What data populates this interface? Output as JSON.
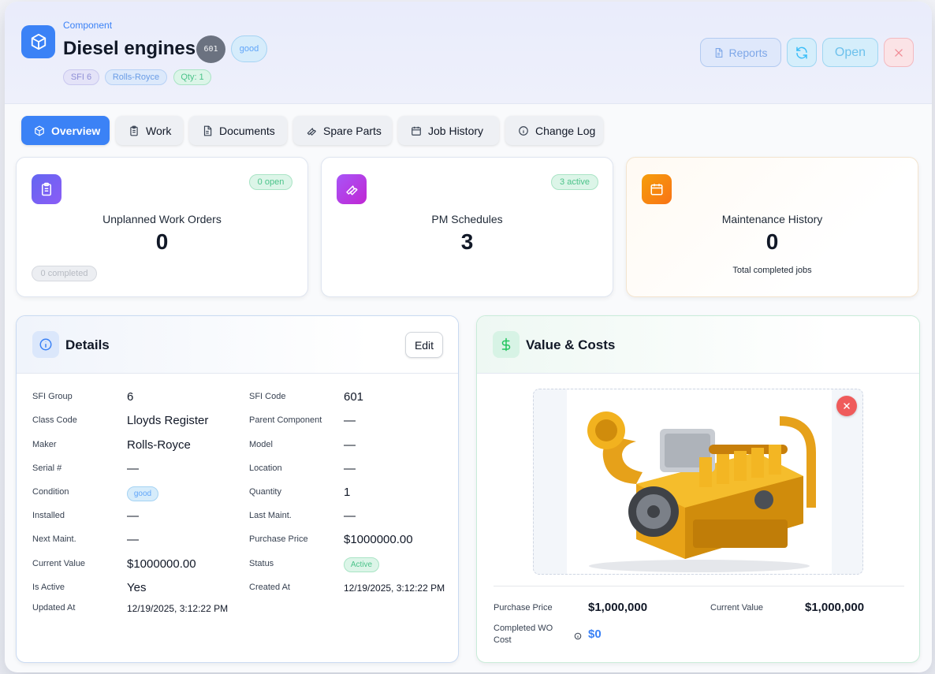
{
  "header": {
    "kicker": "Component",
    "title": "Diesel engines",
    "sfi_code_badge": "601",
    "condition_badge": "good",
    "pills": {
      "sfi": "SFI 6",
      "maker": "Rolls-Royce",
      "qty": "Qty: 1"
    },
    "buttons": {
      "reports": "Reports",
      "open": "Open"
    },
    "icon": "cube-icon"
  },
  "tabs": [
    {
      "label": "Overview",
      "icon": "cube-icon"
    },
    {
      "label": "Work",
      "icon": "clipboard-icon"
    },
    {
      "label": "Documents",
      "icon": "document-icon"
    },
    {
      "label": "Spare Parts",
      "icon": "wrench-icon"
    },
    {
      "label": "Job History",
      "icon": "calendar-icon"
    },
    {
      "label": "Change Log",
      "icon": "info-icon"
    }
  ],
  "stats": {
    "unplanned": {
      "label": "Unplanned Work Orders",
      "value": "0",
      "open_chip": "0 open",
      "completed_chip": "0 completed",
      "color": "#6366f1"
    },
    "pm": {
      "label": "PM Schedules",
      "value": "3",
      "active_chip": "3 active",
      "color": "#a855f7"
    },
    "history": {
      "label": "Maintenance History",
      "value": "0",
      "sub": "Total completed jobs",
      "color": "#f59e0b"
    }
  },
  "details": {
    "title": "Details",
    "edit": "Edit",
    "left": [
      {
        "label": "SFI Group",
        "value": "6"
      },
      {
        "label": "Class Code",
        "value": "Lloyds Register"
      },
      {
        "label": "Maker",
        "value": "Rolls-Royce"
      },
      {
        "label": "Serial #",
        "value": "—"
      },
      {
        "label": "Condition",
        "value": "good"
      },
      {
        "label": "Installed",
        "value": "—"
      },
      {
        "label": "Next Maint.",
        "value": "—"
      },
      {
        "label": "Current Value",
        "value": "$1000000.00"
      },
      {
        "label": "Is Active",
        "value": "Yes"
      },
      {
        "label": "Updated At",
        "value": "12/19/2025, 3:12:22 PM"
      }
    ],
    "right": [
      {
        "label": "SFI Code",
        "value": "601"
      },
      {
        "label": "Parent Component",
        "value": "—"
      },
      {
        "label": "Model",
        "value": "—"
      },
      {
        "label": "Location",
        "value": "—"
      },
      {
        "label": "Quantity",
        "value": "1"
      },
      {
        "label": "Last Maint.",
        "value": "—"
      },
      {
        "label": "Purchase Price",
        "value": "$1000000.00"
      },
      {
        "label": "Status",
        "value": "Active"
      },
      {
        "label": "Created At",
        "value": "12/19/2025, 3:12:22 PM"
      }
    ]
  },
  "value_costs": {
    "title": "Value & Costs",
    "purchase_price_label": "Purchase Price",
    "purchase_price": "$1,000,000",
    "current_value_label": "Current Value",
    "current_value": "$1,000,000",
    "completed_wo_label_1": "Completed WO",
    "completed_wo_label_2": "Cost",
    "completed_wo_cost": "$0",
    "image_subject": "yellow diesel engine"
  },
  "colors": {
    "accent": "#3b82f6",
    "success": "#22c55e",
    "danger": "#ef4444"
  }
}
